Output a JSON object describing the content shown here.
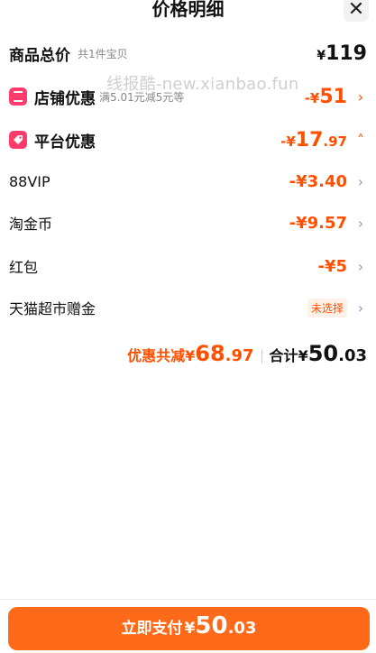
{
  "header": {
    "title": "价格明细",
    "close_icon": "close-icon"
  },
  "watermark": "线报酷-new.xianbao.fun",
  "goods_total": {
    "label": "商品总价",
    "sub": "共1件宝贝",
    "yen": "¥",
    "amount": "119"
  },
  "store_discount": {
    "label": "店铺优惠",
    "sub": "满5.01元减5元等",
    "prefix": "-¥",
    "amount": "51",
    "icon": "store-icon"
  },
  "platform_discount": {
    "label": "平台优惠",
    "prefix": "-¥",
    "amount": "17",
    "decimal": ".97",
    "icon": "tag-icon"
  },
  "items": [
    {
      "label": "88VIP",
      "value": "-¥3.40"
    },
    {
      "label": "淘金币",
      "value": "-¥9.57"
    },
    {
      "label": "红包",
      "value": "-¥5"
    }
  ],
  "tmall_gift": {
    "label": "天猫超市赠金",
    "tag": "未选择"
  },
  "summary": {
    "discount_label": "优惠共减",
    "discount_yen": "¥",
    "discount_int": "68",
    "discount_dec": ".97",
    "total_label": "合计",
    "total_yen": "¥",
    "total_int": "50",
    "total_dec": ".03"
  },
  "pay_button": {
    "label": "立即支付",
    "yen": "¥",
    "int": "50",
    "dec": ".03"
  },
  "colors": {
    "accent": "#ff5000",
    "button": "#ff6a1a",
    "badge": "#ff3b6b"
  }
}
